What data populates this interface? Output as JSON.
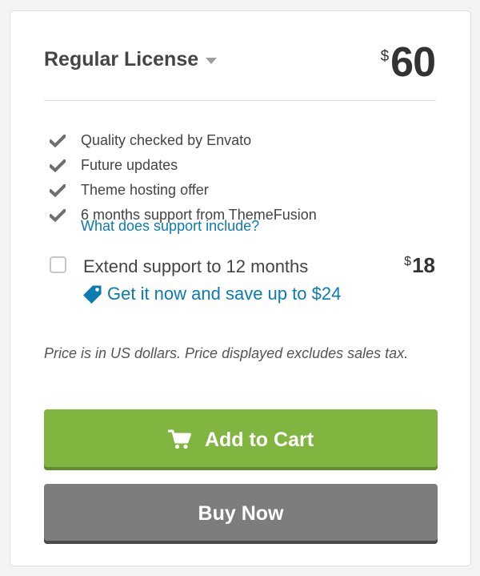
{
  "license": {
    "title": "Regular License",
    "caret_icon": "caret-down-icon",
    "price_currency": "$",
    "price_amount": "60"
  },
  "features": [
    "Quality checked by Envato",
    "Future updates",
    "Theme hosting offer",
    "6 months support from ThemeFusion"
  ],
  "support_link": "What does support include?",
  "extend": {
    "label": "Extend support to 12 months",
    "checked": false,
    "price_currency": "$",
    "price_amount": "18",
    "save_text": "Get it now and save up to $24",
    "save_icon": "tag-icon"
  },
  "note": "Price is in US dollars. Price displayed excludes sales tax.",
  "buttons": {
    "add_to_cart": "Add to Cart",
    "add_to_cart_icon": "cart-icon",
    "buy_now": "Buy Now"
  },
  "colors": {
    "accent_green": "#80b53f",
    "buy_gray": "#7d7d7d",
    "link_blue": "#0b7bb0",
    "check_gray": "#6e6e6e"
  }
}
